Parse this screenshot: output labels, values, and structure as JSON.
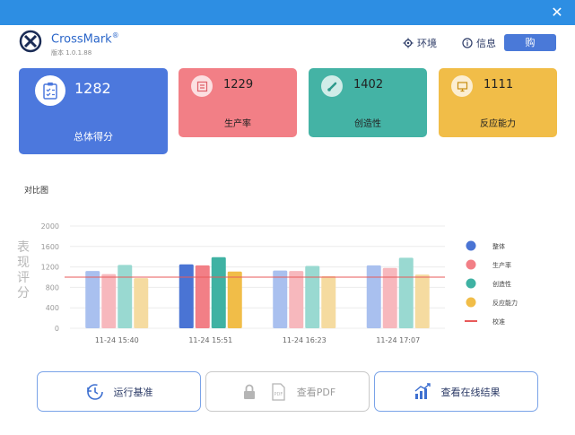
{
  "app": {
    "brand": "CrossMark",
    "registered": "®",
    "version": "版本 1.0.1.88"
  },
  "header": {
    "environment_label": "环境",
    "info_label": "信息",
    "buy_label": "购"
  },
  "cards": {
    "overall": {
      "score": "1282",
      "label": "总体得分"
    },
    "productivity": {
      "score": "1229",
      "label": "生产率"
    },
    "creativity": {
      "score": "1402",
      "label": "创造性"
    },
    "responsiveness": {
      "score": "1111",
      "label": "反应能力"
    }
  },
  "comparison": {
    "title": "对比图",
    "y_axis_label": "表现评分"
  },
  "chart_data": {
    "type": "bar",
    "y_ticks": [
      "2000",
      "1600",
      "1200",
      "800",
      "400",
      "0"
    ],
    "ylim": [
      0,
      2000
    ],
    "categories": [
      "11-24 15:40",
      "11-24 15:51",
      "11-24 16:23",
      "11-24 17:07"
    ],
    "series": [
      {
        "name": "整体",
        "color": "#4a74d4",
        "light": "#a9c0ef",
        "values": [
          1120,
          1250,
          1130,
          1230
        ]
      },
      {
        "name": "生产率",
        "color": "#f27f86",
        "light": "#f7b8bd",
        "values": [
          1060,
          1230,
          1120,
          1180
        ]
      },
      {
        "name": "创造性",
        "color": "#3fb2a3",
        "light": "#99d9d1",
        "values": [
          1240,
          1390,
          1220,
          1380
        ]
      },
      {
        "name": "反应能力",
        "color": "#f1bd48",
        "light": "#f5dba0",
        "values": [
          980,
          1110,
          1020,
          1050
        ]
      }
    ],
    "reference": {
      "name": "校准",
      "color": "#e85a5a",
      "value": 1000
    },
    "highlighted_category_index": 1,
    "legend_position": "right"
  },
  "actions": {
    "run_benchmark": "运行基准",
    "view_pdf": "查看PDF",
    "view_online": "查看在线结果"
  }
}
